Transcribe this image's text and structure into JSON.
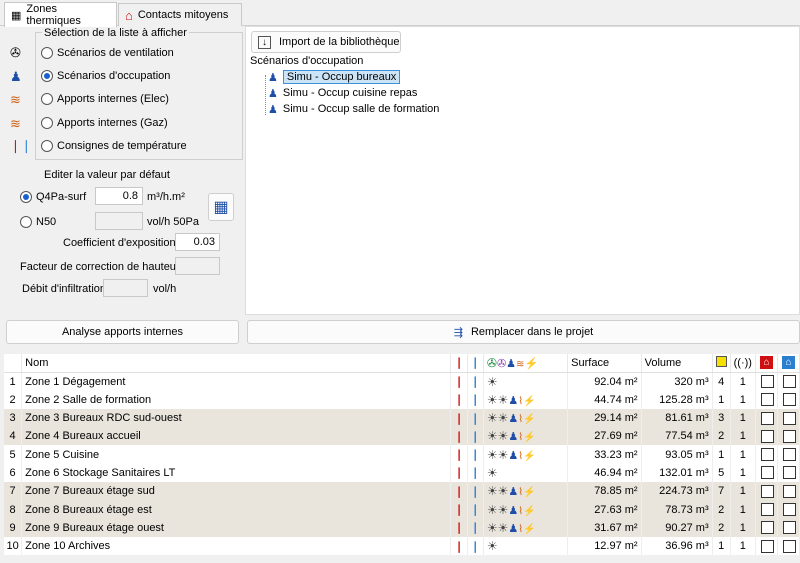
{
  "tabs": [
    {
      "label": "Zones thermiques",
      "icon": "grid-icon"
    },
    {
      "label": "Contacts mitoyens",
      "icon": "house-icon"
    }
  ],
  "left": {
    "group_title": "Sélection de la liste à afficher",
    "options": [
      {
        "label": "Scénarios de ventilation",
        "selected": false,
        "icon": "fan-icon"
      },
      {
        "label": "Scénarios d'occupation",
        "selected": true,
        "icon": "person-icon"
      },
      {
        "label": "Apports internes (Elec)",
        "selected": false,
        "icon": "heat-icon"
      },
      {
        "label": "Apports internes (Gaz)",
        "selected": false,
        "icon": "heat-icon"
      },
      {
        "label": "Consignes de température",
        "selected": false,
        "icon": "thermometer-icon"
      }
    ],
    "edit_title": "Editer la valeur par défaut",
    "q4pa_label": "Q4Pa-surf",
    "q4pa_value": "0.8",
    "q4pa_unit": "m³/h.m²",
    "n50_label": "N50",
    "n50_unit": "vol/h 50Pa",
    "coef_label": "Coefficient d'exposition",
    "coef_value": "0.03",
    "height_label": "Facteur de correction de hauteur",
    "infil_label": "Débit d'infiltration",
    "infil_unit": "vol/h",
    "analyse_button": "Analyse apports internes"
  },
  "right": {
    "import_button": "Import de la bibliothèque",
    "scenarios_title": "Scénarios d'occupation",
    "scenarios": [
      "Simu - Occup bureaux",
      "Simu - Occup cuisine repas",
      "Simu - Occup salle de formation"
    ],
    "replace_button": "Remplacer dans le projet"
  },
  "table": {
    "headers": {
      "nom": "Nom",
      "surface": "Surface",
      "volume": "Volume"
    },
    "rows": [
      {
        "idx": "1",
        "nom": "Zone 1 Dégagement",
        "surface": "92.04 m²",
        "volume": "320 m³",
        "a": "4",
        "b": "1",
        "fans": "☀",
        "pers": "",
        "heat": ""
      },
      {
        "idx": "2",
        "nom": "Zone 2 Salle de formation",
        "surface": "44.74 m²",
        "volume": "125.28 m³",
        "a": "1",
        "b": "1",
        "fans": "☀☀",
        "pers": "♟",
        "heat": "⌇⚡"
      },
      {
        "idx": "3",
        "nom": "Zone 3 Bureaux RDC sud-ouest",
        "surface": "29.14 m²",
        "volume": "81.61 m³",
        "a": "3",
        "b": "1",
        "fans": "☀☀",
        "pers": "♟",
        "heat": "⌇⚡"
      },
      {
        "idx": "4",
        "nom": "Zone 4 Bureaux accueil",
        "surface": "27.69 m²",
        "volume": "77.54 m³",
        "a": "2",
        "b": "1",
        "fans": "☀☀",
        "pers": "♟",
        "heat": "⌇⚡"
      },
      {
        "idx": "5",
        "nom": "Zone 5 Cuisine",
        "surface": "33.23 m²",
        "volume": "93.05 m³",
        "a": "1",
        "b": "1",
        "fans": "☀☀",
        "pers": "♟",
        "heat": "⌇⚡"
      },
      {
        "idx": "6",
        "nom": "Zone 6 Stockage Sanitaires LT",
        "surface": "46.94 m²",
        "volume": "132.01 m³",
        "a": "5",
        "b": "1",
        "fans": "☀",
        "pers": "",
        "heat": ""
      },
      {
        "idx": "7",
        "nom": "Zone 7 Bureaux étage sud",
        "surface": "78.85 m²",
        "volume": "224.73 m³",
        "a": "7",
        "b": "1",
        "fans": "☀☀",
        "pers": "♟",
        "heat": "⌇⚡"
      },
      {
        "idx": "8",
        "nom": "Zone 8 Bureaux étage est",
        "surface": "27.63 m²",
        "volume": "78.73 m³",
        "a": "2",
        "b": "1",
        "fans": "☀☀",
        "pers": "♟",
        "heat": "⌇⚡"
      },
      {
        "idx": "9",
        "nom": "Zone 9 Bureaux étage ouest",
        "surface": "31.67 m²",
        "volume": "90.27 m³",
        "a": "2",
        "b": "1",
        "fans": "☀☀",
        "pers": "♟",
        "heat": "⌇⚡"
      },
      {
        "idx": "10",
        "nom": "Zone 10 Archives",
        "surface": "12.97 m²",
        "volume": "36.96 m³",
        "a": "1",
        "b": "1",
        "fans": "☀",
        "pers": "",
        "heat": ""
      }
    ]
  },
  "colors": {
    "selection": "#cce4f7",
    "alt_row": "#e9e4dc",
    "red": "#d01010",
    "blue": "#2a7fd0"
  }
}
